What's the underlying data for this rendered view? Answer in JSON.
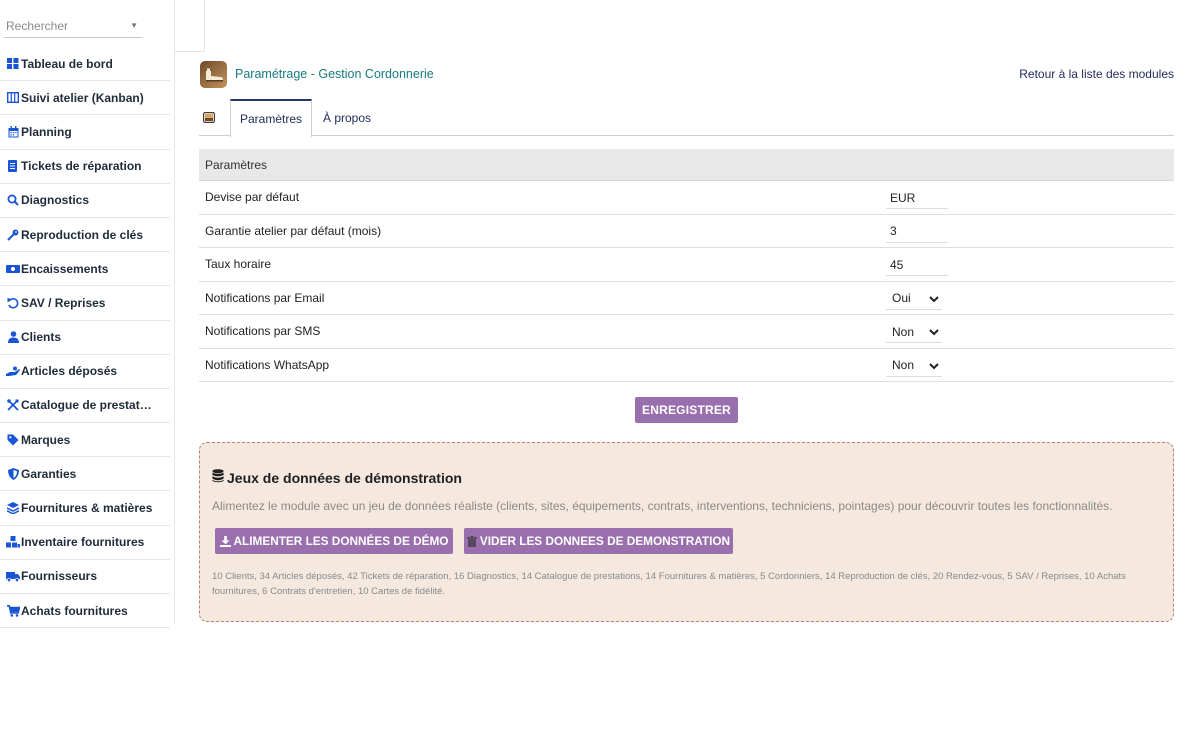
{
  "sidebar": {
    "search_placeholder": "Rechercher",
    "items": [
      {
        "label": "Tableau de bord",
        "icon": "dashboard-icon"
      },
      {
        "label": "Suivi atelier (Kanban)",
        "icon": "kanban-icon"
      },
      {
        "label": "Planning",
        "icon": "calendar-icon"
      },
      {
        "label": "Tickets de réparation",
        "icon": "ticket-icon"
      },
      {
        "label": "Diagnostics",
        "icon": "search-icon"
      },
      {
        "label": "Reproduction de clés",
        "icon": "key-icon"
      },
      {
        "label": "Encaissements",
        "icon": "cash-icon"
      },
      {
        "label": "SAV / Reprises",
        "icon": "undo-icon"
      },
      {
        "label": "Clients",
        "icon": "user-icon"
      },
      {
        "label": "Articles déposés",
        "icon": "hand-icon"
      },
      {
        "label": "Catalogue de prestat…",
        "icon": "tools-icon"
      },
      {
        "label": "Marques",
        "icon": "tag-icon"
      },
      {
        "label": "Garanties",
        "icon": "shield-icon"
      },
      {
        "label": "Fournitures & matières",
        "icon": "layers-icon"
      },
      {
        "label": "Inventaire fournitures",
        "icon": "boxes-icon"
      },
      {
        "label": "Fournisseurs",
        "icon": "truck-icon"
      },
      {
        "label": "Achats fournitures",
        "icon": "cart-icon"
      }
    ]
  },
  "header": {
    "title": "Paramétrage - Gestion Cordonnerie",
    "back_link": "Retour à la liste des modules"
  },
  "tabs": [
    {
      "label": "Paramètres",
      "active": true
    },
    {
      "label": "À propos",
      "active": false
    }
  ],
  "params": {
    "heading": "Paramètres",
    "rows": [
      {
        "label": "Devise par défaut",
        "type": "input",
        "value": "EUR"
      },
      {
        "label": "Garantie atelier par défaut (mois)",
        "type": "input",
        "value": "3"
      },
      {
        "label": "Taux horaire",
        "type": "input",
        "value": "45"
      },
      {
        "label": "Notifications par Email",
        "type": "select",
        "value": "Oui"
      },
      {
        "label": "Notifications par SMS",
        "type": "select",
        "value": "Non"
      },
      {
        "label": "Notifications WhatsApp",
        "type": "select",
        "value": "Non"
      }
    ],
    "save_label": "ENREGISTRER"
  },
  "demo": {
    "title": "Jeux de données de démonstration",
    "description": "Alimentez le module avec un jeu de données réaliste (clients, sites, équipements, contrats, interventions, techniciens, pointages) pour découvrir toutes les fonctionnalités.",
    "fill_label": "ALIMENTER LES DONNÉES DE DÉMO",
    "clear_label": "VIDER LES DONNEES DE DEMONSTRATION",
    "stats": "10 Clients, 34 Articles déposés, 42 Tickets de réparation, 16 Diagnostics, 14 Catalogue de prestations, 14 Fournitures & matières, 5 Cordonniers, 14 Reproduction de clés, 20 Rendez-vous, 5 SAV / Reprises, 10 Achats fournitures, 6 Contrats d'entretien, 10 Cartes de fidélité."
  },
  "colors": {
    "icon_blue": "#1a55d6",
    "title_teal": "#177a7e",
    "button_purple": "#9a6fae",
    "demo_bg": "#f4e8df",
    "demo_border": "#b8826a"
  }
}
